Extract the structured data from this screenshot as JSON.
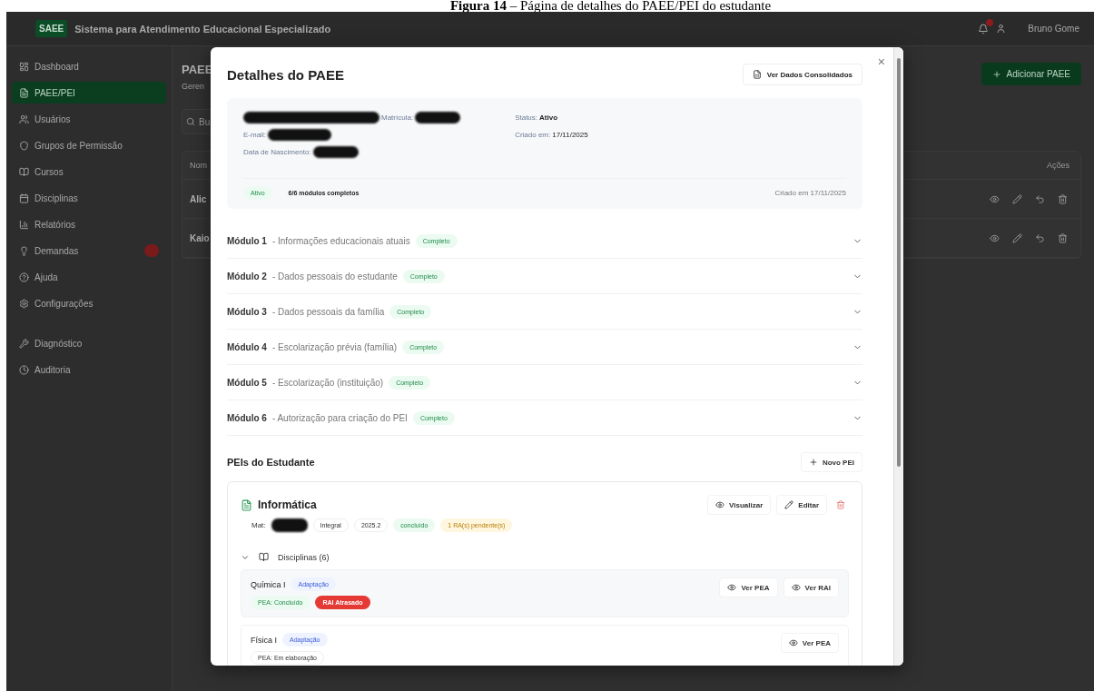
{
  "caption": "**Figura 14** – Página de detalhes do PAEE/PEI do estudante",
  "header": {
    "logo": "SAEE",
    "title": "Sistema para Atendimento Educacional Especializado",
    "user": "Bruno Gome"
  },
  "sidebar": {
    "sections": [
      [
        {
          "label": "Dashboard",
          "selected": false,
          "badge": false
        },
        {
          "label": "PAEE/PEI",
          "selected": true,
          "badge": false
        },
        {
          "label": "Usuários",
          "selected": false,
          "badge": false
        },
        {
          "label": "Grupos de Permissão",
          "selected": false,
          "badge": false
        },
        {
          "label": "Cursos",
          "selected": false,
          "badge": false
        },
        {
          "label": "Disciplinas",
          "selected": false,
          "badge": false
        },
        {
          "label": "Relatórios",
          "selected": false,
          "badge": false
        },
        {
          "label": "Demandas",
          "selected": false,
          "badge": true
        },
        {
          "label": "Ajuda",
          "selected": false,
          "badge": false
        },
        {
          "label": "Configurações",
          "selected": false,
          "badge": false
        }
      ],
      [
        {
          "label": "Diagnóstico",
          "selected": false,
          "badge": false
        },
        {
          "label": "Auditoria",
          "selected": false,
          "badge": false
        }
      ]
    ]
  },
  "page": {
    "title": "PAEE",
    "subtitle": "Geren",
    "search": {
      "placeholder": "Bu"
    },
    "add_button": "Adicionar PAEE",
    "columns": [
      "Nom",
      "Ações"
    ],
    "rows": [
      "Alic",
      "Kaio"
    ]
  },
  "modal": {
    "title": "Detalhes do PAEE",
    "consolidated_button": "Ver Dados Consolidados",
    "close": "×",
    "student": {
      "matricula_label": "Matrícula:",
      "email_label": "E-mail:",
      "birth_label": "Data de Nascimento:",
      "status_label": "Status:",
      "status": "Ativo",
      "created_label": "Criado em:",
      "created": "17/11/2025",
      "badges": [
        {
          "text": "Ativo",
          "kind": "success"
        },
        {
          "text": "6/6 módulos completos",
          "kind": "plain"
        }
      ],
      "footer": "Criado em 17/11/2025"
    },
    "modules": [
      {
        "label": "Módulo 1",
        "description": "- Informações educacionais atuais",
        "badge": "Completo",
        "expanded": false
      },
      {
        "label": "Módulo 2",
        "description": "- Dados pessoais do estudante",
        "badge": "Completo",
        "expanded": false
      },
      {
        "label": "Módulo 3",
        "description": "- Dados pessoais da família",
        "badge": "Completo",
        "expanded": false
      },
      {
        "label": "Módulo 4",
        "description": "- Escolarização prévia (família)",
        "badge": "Completo",
        "expanded": false
      },
      {
        "label": "Módulo 5",
        "description": "- Escolarização (instituição)",
        "badge": "Completo",
        "expanded": false
      },
      {
        "label": "Módulo 6",
        "description": "- Autorização para criação do PEI",
        "badge": "Completo",
        "expanded": false
      }
    ],
    "peis": {
      "title": "PEIs do Estudante",
      "new_button": "Novo PEI",
      "cards": [
        {
          "name": "Informática",
          "mat_label": "Mat:",
          "tags": [
            {
              "text": "Integral",
              "kind": "neutral"
            },
            {
              "text": "2025.2",
              "kind": "neutral"
            },
            {
              "text": "concluído",
              "kind": "success"
            },
            {
              "text": "1 RA(s) pendente(s)",
              "kind": "warning"
            }
          ],
          "view_button": "Visualizar",
          "edit_button": "Editar",
          "subjects_label": "Disciplinas (6)",
          "subjects_expanded": true,
          "subjects": [
            {
              "name": "Química I",
              "type": "Adaptação",
              "tags": [
                {
                  "text": "PEA: Concluído",
                  "kind": "success"
                },
                {
                  "text": "RAI Atrasado",
                  "kind": "danger"
                }
              ],
              "buttons": [
                "Ver PEA",
                "Ver RAI"
              ]
            },
            {
              "name": "Física I",
              "type": "Adaptação",
              "tags": [
                {
                  "text": "PEA: Em elaboração",
                  "kind": "neutral"
                }
              ],
              "buttons": [
                "Ver PEA"
              ]
            }
          ]
        }
      ]
    }
  }
}
